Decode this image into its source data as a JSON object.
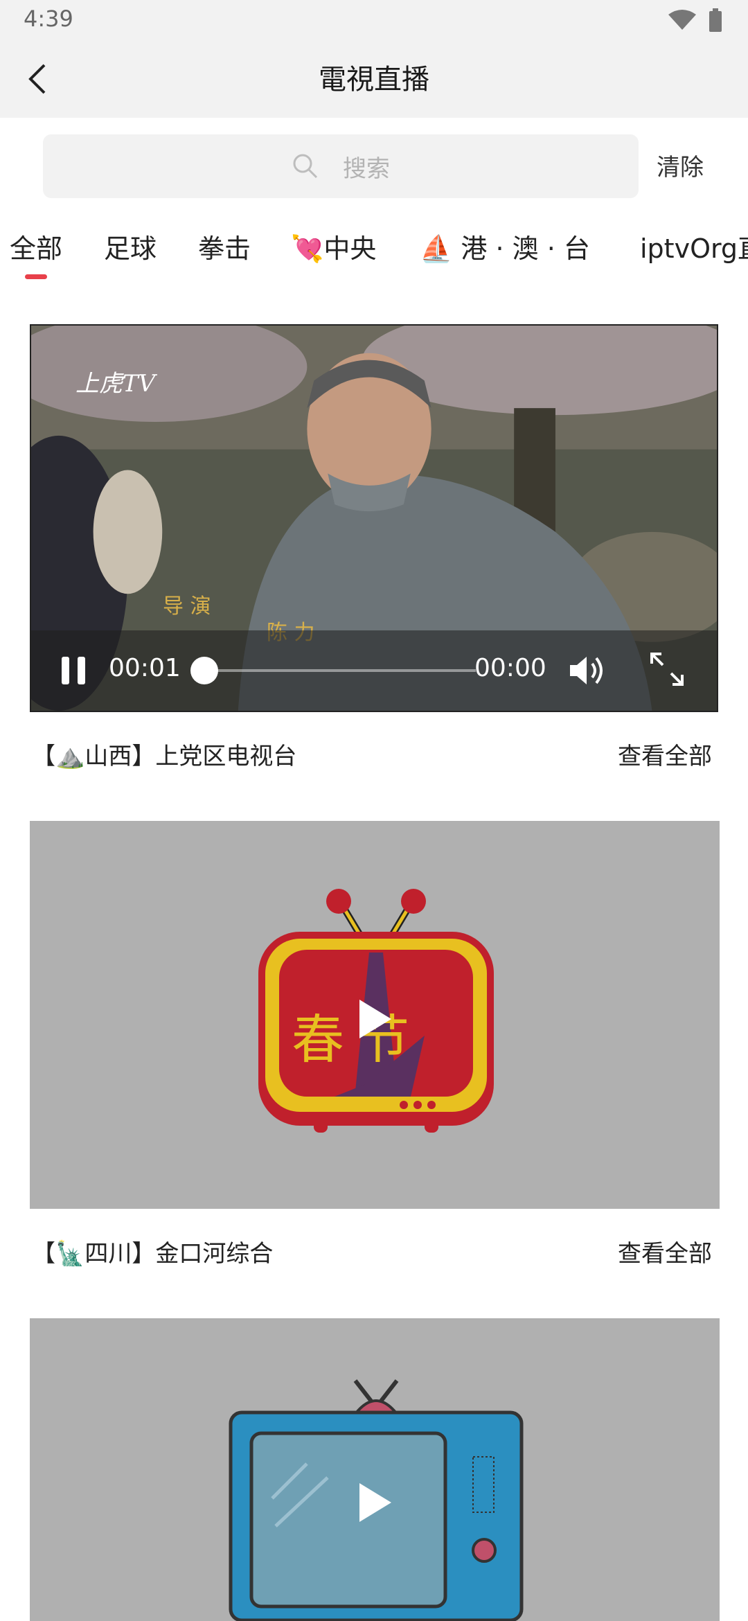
{
  "status": {
    "time": "4:39"
  },
  "header": {
    "title": "電視直播"
  },
  "search": {
    "placeholder": "搜索",
    "clear_label": "清除"
  },
  "tabs": [
    {
      "label": "全部",
      "selected": true
    },
    {
      "label": "足球"
    },
    {
      "label": "拳击"
    },
    {
      "label": "💘中央"
    },
    {
      "label": "⛵ 港 · 澳 · 台"
    },
    {
      "label": "iptvOrg直"
    }
  ],
  "player": {
    "watermark": "上虎TV",
    "credit_label": "导 演",
    "credit_name": "陈 力",
    "current_time": "00:01",
    "duration": "00:00",
    "progress": 0
  },
  "channels": [
    {
      "caption": "【⛰️山西】上党区电视台",
      "more": "查看全部"
    },
    {
      "caption": "【🗽四川】金口河综合",
      "more": "查看全部",
      "logo_text": "春节"
    },
    {
      "caption": "",
      "more": ""
    }
  ],
  "colors": {
    "accent": "#e8404a",
    "thumb_bg": "#b0b0b0",
    "tv_blue": "#2b8fc0",
    "tv_red": "#c0202c",
    "tv_yellow": "#e8c020"
  }
}
